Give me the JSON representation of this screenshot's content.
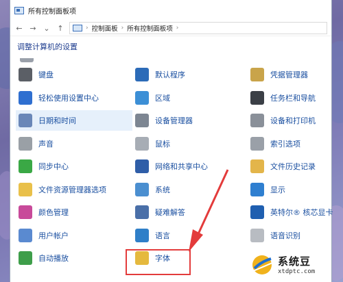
{
  "window": {
    "title": "所有控制面板项"
  },
  "nav": {
    "back": "←",
    "forward": "→",
    "recent": "⌄",
    "up": "↑"
  },
  "address": {
    "parts": [
      "控制面板",
      "所有控制面板项"
    ],
    "separator": "›"
  },
  "header": {
    "text": "调整计算机的设置"
  },
  "items": {
    "col1": [
      {
        "label": "键盘",
        "icon": "keyboard-icon",
        "color": "#5b5f66"
      },
      {
        "label": "轻松使用设置中心",
        "icon": "accessibility-icon",
        "color": "#2f6fd0"
      },
      {
        "label": "日期和时间",
        "icon": "clock-icon",
        "color": "#6a87b8",
        "selected": true
      },
      {
        "label": "声音",
        "icon": "speaker-icon",
        "color": "#9aa0a6"
      },
      {
        "label": "同步中心",
        "icon": "sync-icon",
        "color": "#3aa845"
      },
      {
        "label": "文件资源管理器选项",
        "icon": "folder-options-icon",
        "color": "#e9c04a"
      },
      {
        "label": "颜色管理",
        "icon": "color-management-icon",
        "color": "#c84a9a"
      },
      {
        "label": "用户帐户",
        "icon": "users-icon",
        "color": "#5a8ad0"
      },
      {
        "label": "自动播放",
        "icon": "autoplay-icon",
        "color": "#3e9e4a"
      }
    ],
    "col2": [
      {
        "label": "默认程序",
        "icon": "default-programs-icon",
        "color": "#2c6bb8"
      },
      {
        "label": "区域",
        "icon": "globe-icon",
        "color": "#3c8fd6"
      },
      {
        "label": "设备管理器",
        "icon": "device-manager-icon",
        "color": "#7d8692"
      },
      {
        "label": "鼠标",
        "icon": "mouse-icon",
        "color": "#a7adb5"
      },
      {
        "label": "网络和共享中心",
        "icon": "network-icon",
        "color": "#2f5ea8"
      },
      {
        "label": "系统",
        "icon": "system-icon",
        "color": "#4b8fd0"
      },
      {
        "label": "疑难解答",
        "icon": "troubleshoot-icon",
        "color": "#4a6fa8"
      },
      {
        "label": "语言",
        "icon": "language-icon",
        "color": "#2f7fc8"
      },
      {
        "label": "字体",
        "icon": "fonts-icon",
        "color": "#e5b93e"
      }
    ],
    "col3": [
      {
        "label": "凭据管理器",
        "icon": "credential-icon",
        "color": "#c9a44a"
      },
      {
        "label": "任务栏和导航",
        "icon": "taskbar-icon",
        "color": "#3b3f46"
      },
      {
        "label": "设备和打印机",
        "icon": "printer-icon",
        "color": "#8a9099"
      },
      {
        "label": "索引选项",
        "icon": "search-index-icon",
        "color": "#9aa0a8"
      },
      {
        "label": "文件历史记录",
        "icon": "file-history-icon",
        "color": "#e3b54a"
      },
      {
        "label": "显示",
        "icon": "display-icon",
        "color": "#2f7fd0"
      },
      {
        "label": "英特尔® 核芯显卡",
        "icon": "intel-graphics-icon",
        "color": "#1f5fb0"
      },
      {
        "label": "语音识别",
        "icon": "microphone-icon",
        "color": "#b8bcc2"
      }
    ]
  },
  "watermark": {
    "title": "系统豆",
    "url": "xtdptc.com"
  },
  "colors": {
    "highlight": "#e33b3b",
    "link": "#1a4fa0",
    "header": "#1e3d8f"
  }
}
